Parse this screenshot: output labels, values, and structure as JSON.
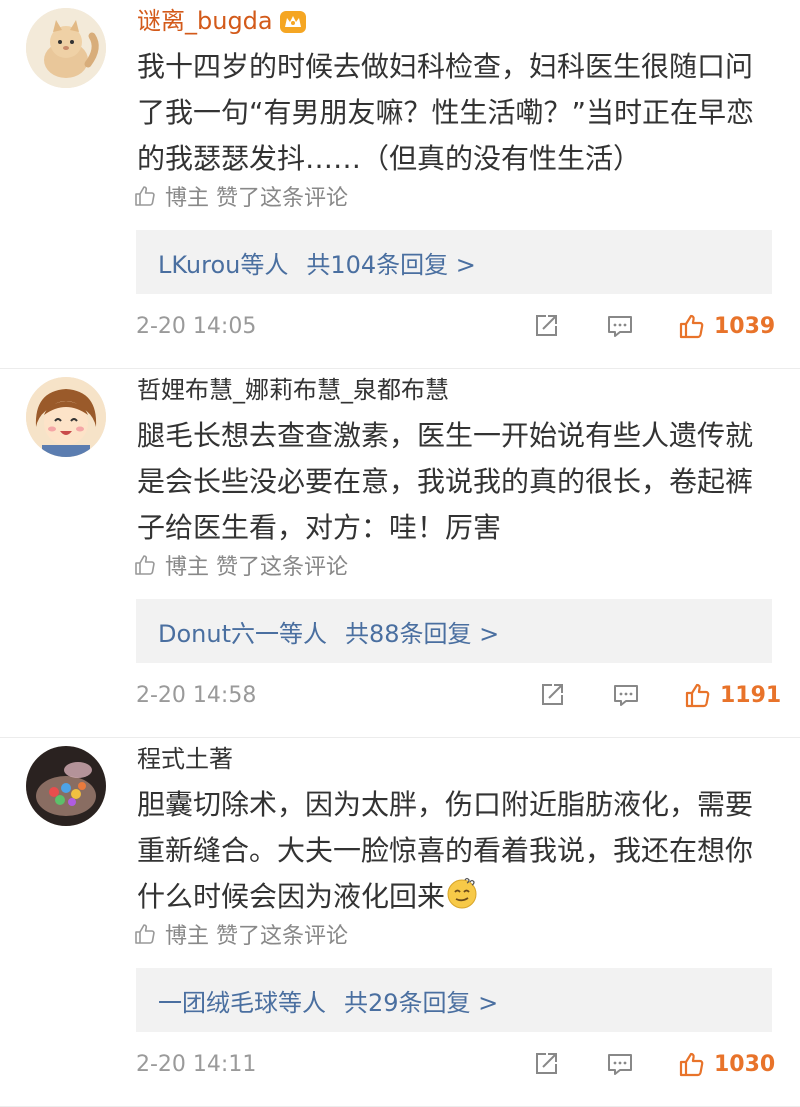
{
  "colors": {
    "vip_username": "#d35a1a",
    "normal_username": "#333333",
    "reply_link": "#4a6fa0",
    "like_accent": "#e8732a",
    "meta_gray": "#9a9a9a",
    "reply_bg": "#f2f2f2"
  },
  "comments": [
    {
      "username": "谜离_bugda",
      "badge_icon": "crown-icon",
      "content": "我十四岁的时候去做妇科检查，妇科医生很随口问了我一句“有男朋友嘛？性生活嘞？”当时正在早恋的我瑟瑟发抖……（但真的没有性生活）",
      "liked_by_blogger": "博主 赞了这条评论",
      "reply_users": "LKurou等人",
      "reply_count": "共104条回复 >",
      "time": "2-20 14:05",
      "likes": "1039"
    },
    {
      "username": "哲娌布慧_娜莉布慧_泉都布慧",
      "content": "腿毛长想去查查激素，医生一开始说有些人遗传就是会长些没必要在意，我说我的真的很长，卷起裤子给医生看，对方：哇！厉害",
      "liked_by_blogger": "博主 赞了这条评论",
      "reply_users": "Donut六一等人",
      "reply_count": "共88条回复 >",
      "time": "2-20 14:58",
      "likes": "1191"
    },
    {
      "username": "程式土著",
      "content": "胆囊切除术，因为太胖，伤口附近脂肪液化，需要重新缝合。大夫一脸惊喜的看着我说，我还在想你什么时候会因为液化回来",
      "content_emoji": "dizzy-face-emoji",
      "liked_by_blogger": "博主 赞了这条评论",
      "reply_users": "一团绒毛球等人",
      "reply_count": "共29条回复 >",
      "time": "2-20 14:11",
      "likes": "1030"
    }
  ]
}
